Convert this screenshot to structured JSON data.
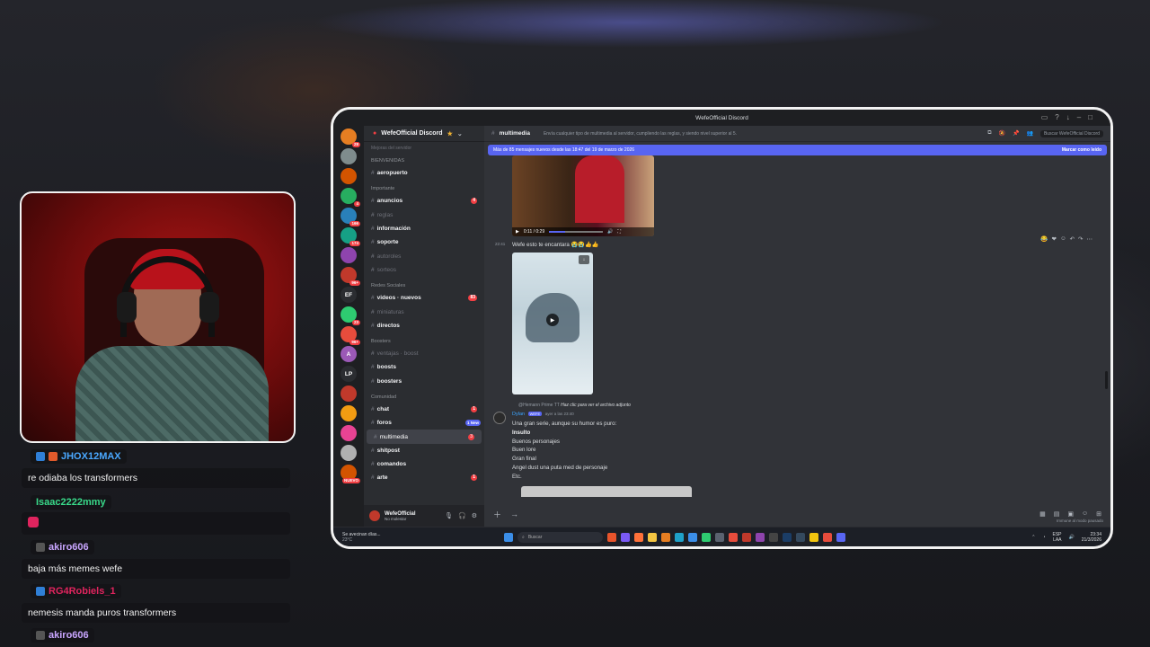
{
  "chat": [
    {
      "user": "JHOX12MAX",
      "color": "#4aa8ff",
      "text": "re odiaba los transformers"
    },
    {
      "user": "Isaac2222mmy",
      "color": "#39d98a",
      "text": ""
    },
    {
      "user": "akiro606",
      "color": "#c9a6ff",
      "text": "baja más memes wefe"
    },
    {
      "user": "RG4Robiels_1",
      "color": "#e0245e",
      "text": "nemesis manda puros transformers"
    },
    {
      "user": "akiro606",
      "color": "#c9a6ff",
      "text": ""
    }
  ],
  "window": {
    "title": "WefeOfficial Discord"
  },
  "server": {
    "name": "WefeOfficial Discord",
    "top_partial": "Mejoras del servidor"
  },
  "channels": {
    "cat_bienvenidas": "BIENVENIDAS",
    "aeropuerto": "aeropuerto",
    "cat_importante": "Importante",
    "anuncios": "anuncios",
    "anuncios_badge": "4",
    "reglas": "reglas",
    "informacion": "información",
    "soporte": "soporte",
    "autoroles": "autoroles",
    "sorteos": "sorteos",
    "cat_redes": "Redes Sociales",
    "videos": "videos · nuevos",
    "videos_badge": "83",
    "miniaturas": "miniaturas",
    "directos": "directos",
    "cat_boosters": "Boosters",
    "ventajas": "ventajas · boost",
    "boosts": "boosts",
    "boosters": "boosters",
    "cat_comunidad": "Comunidad",
    "chat": "chat",
    "chat_badge": "1",
    "foros": "foros",
    "foros_badge": "1 New",
    "multimedia": "multimedia",
    "multimedia_badge": "3",
    "shitpost": "shitpost",
    "comandos": "comandos",
    "arte": "arte",
    "arte_badge": "1"
  },
  "guilds": [
    {
      "label": "",
      "color": "#e67e22",
      "badge": "28"
    },
    {
      "label": "",
      "color": "#7f8c8d",
      "badge": ""
    },
    {
      "label": "",
      "color": "#d35400",
      "badge": ""
    },
    {
      "label": "",
      "color": "#27ae60",
      "badge": "4"
    },
    {
      "label": "",
      "color": "#2980b9",
      "badge": "166"
    },
    {
      "label": "",
      "color": "#16a085",
      "badge": "174"
    },
    {
      "label": "",
      "color": "#8e44ad",
      "badge": ""
    },
    {
      "label": "",
      "color": "#c0392b",
      "badge": "96+"
    },
    {
      "label": "EF",
      "color": "#2b2d31",
      "badge": ""
    },
    {
      "label": "",
      "color": "#2ecc71",
      "badge": "23"
    },
    {
      "label": "",
      "color": "#e74c3c",
      "badge": "96+"
    },
    {
      "label": "A",
      "color": "#9b59b6",
      "badge": ""
    },
    {
      "label": "LP",
      "color": "#2b2d31",
      "badge": ""
    },
    {
      "label": "",
      "color": "#c0392b",
      "badge": ""
    },
    {
      "label": "",
      "color": "#f39c12",
      "badge": ""
    },
    {
      "label": "",
      "color": "#e84393",
      "badge": ""
    },
    {
      "label": "",
      "color": "#b0b0b0",
      "badge": ""
    },
    {
      "label": "",
      "color": "#d35400",
      "badge": "NUEVO"
    }
  ],
  "header": {
    "channel": "multimedia",
    "topic": "Envía cualquier tipo de multimedia al servidor, cumpliendo las reglas, y siendo nivel superior al 5.",
    "search": "Buscar WefeOfficial Discord"
  },
  "banner": {
    "text": "Más de 85 mensajes nuevos desde las 18:47 del 19 de marzo de 2026",
    "action": "Marcar como leído"
  },
  "video1": {
    "time": "0:11 / 0:29"
  },
  "msg1": {
    "time": "22:41",
    "text": "Wefe esto te encantara 😭😭👍👍"
  },
  "reply": {
    "from": "@Hemann Prime TT",
    "note": "Haz clic para ver el archivo adjunto"
  },
  "msg2": {
    "author": "Dylan",
    "tag": "WEFE",
    "timestamp": "ayer a las 23:40",
    "lines": [
      "Una gran serie, aunque su humor es puro:",
      "Insulto",
      "Buenos personajes",
      "Buen lore",
      "Gran final",
      "Angel dust una puta med de personaje",
      "Etc."
    ]
  },
  "status_right": "Immune al modo pausado",
  "user": {
    "name": "WefeOfficial",
    "status": "No molestar"
  },
  "taskbar": {
    "weather": "Se avecinan días...",
    "temp": "23°C",
    "search": "Buscar",
    "lang": "ESP",
    "lang2": "LAA",
    "time": "23:34",
    "date": "21/3/2026"
  },
  "colors": {
    "accent": "#5865f2",
    "frame": "#f2f2f2"
  }
}
